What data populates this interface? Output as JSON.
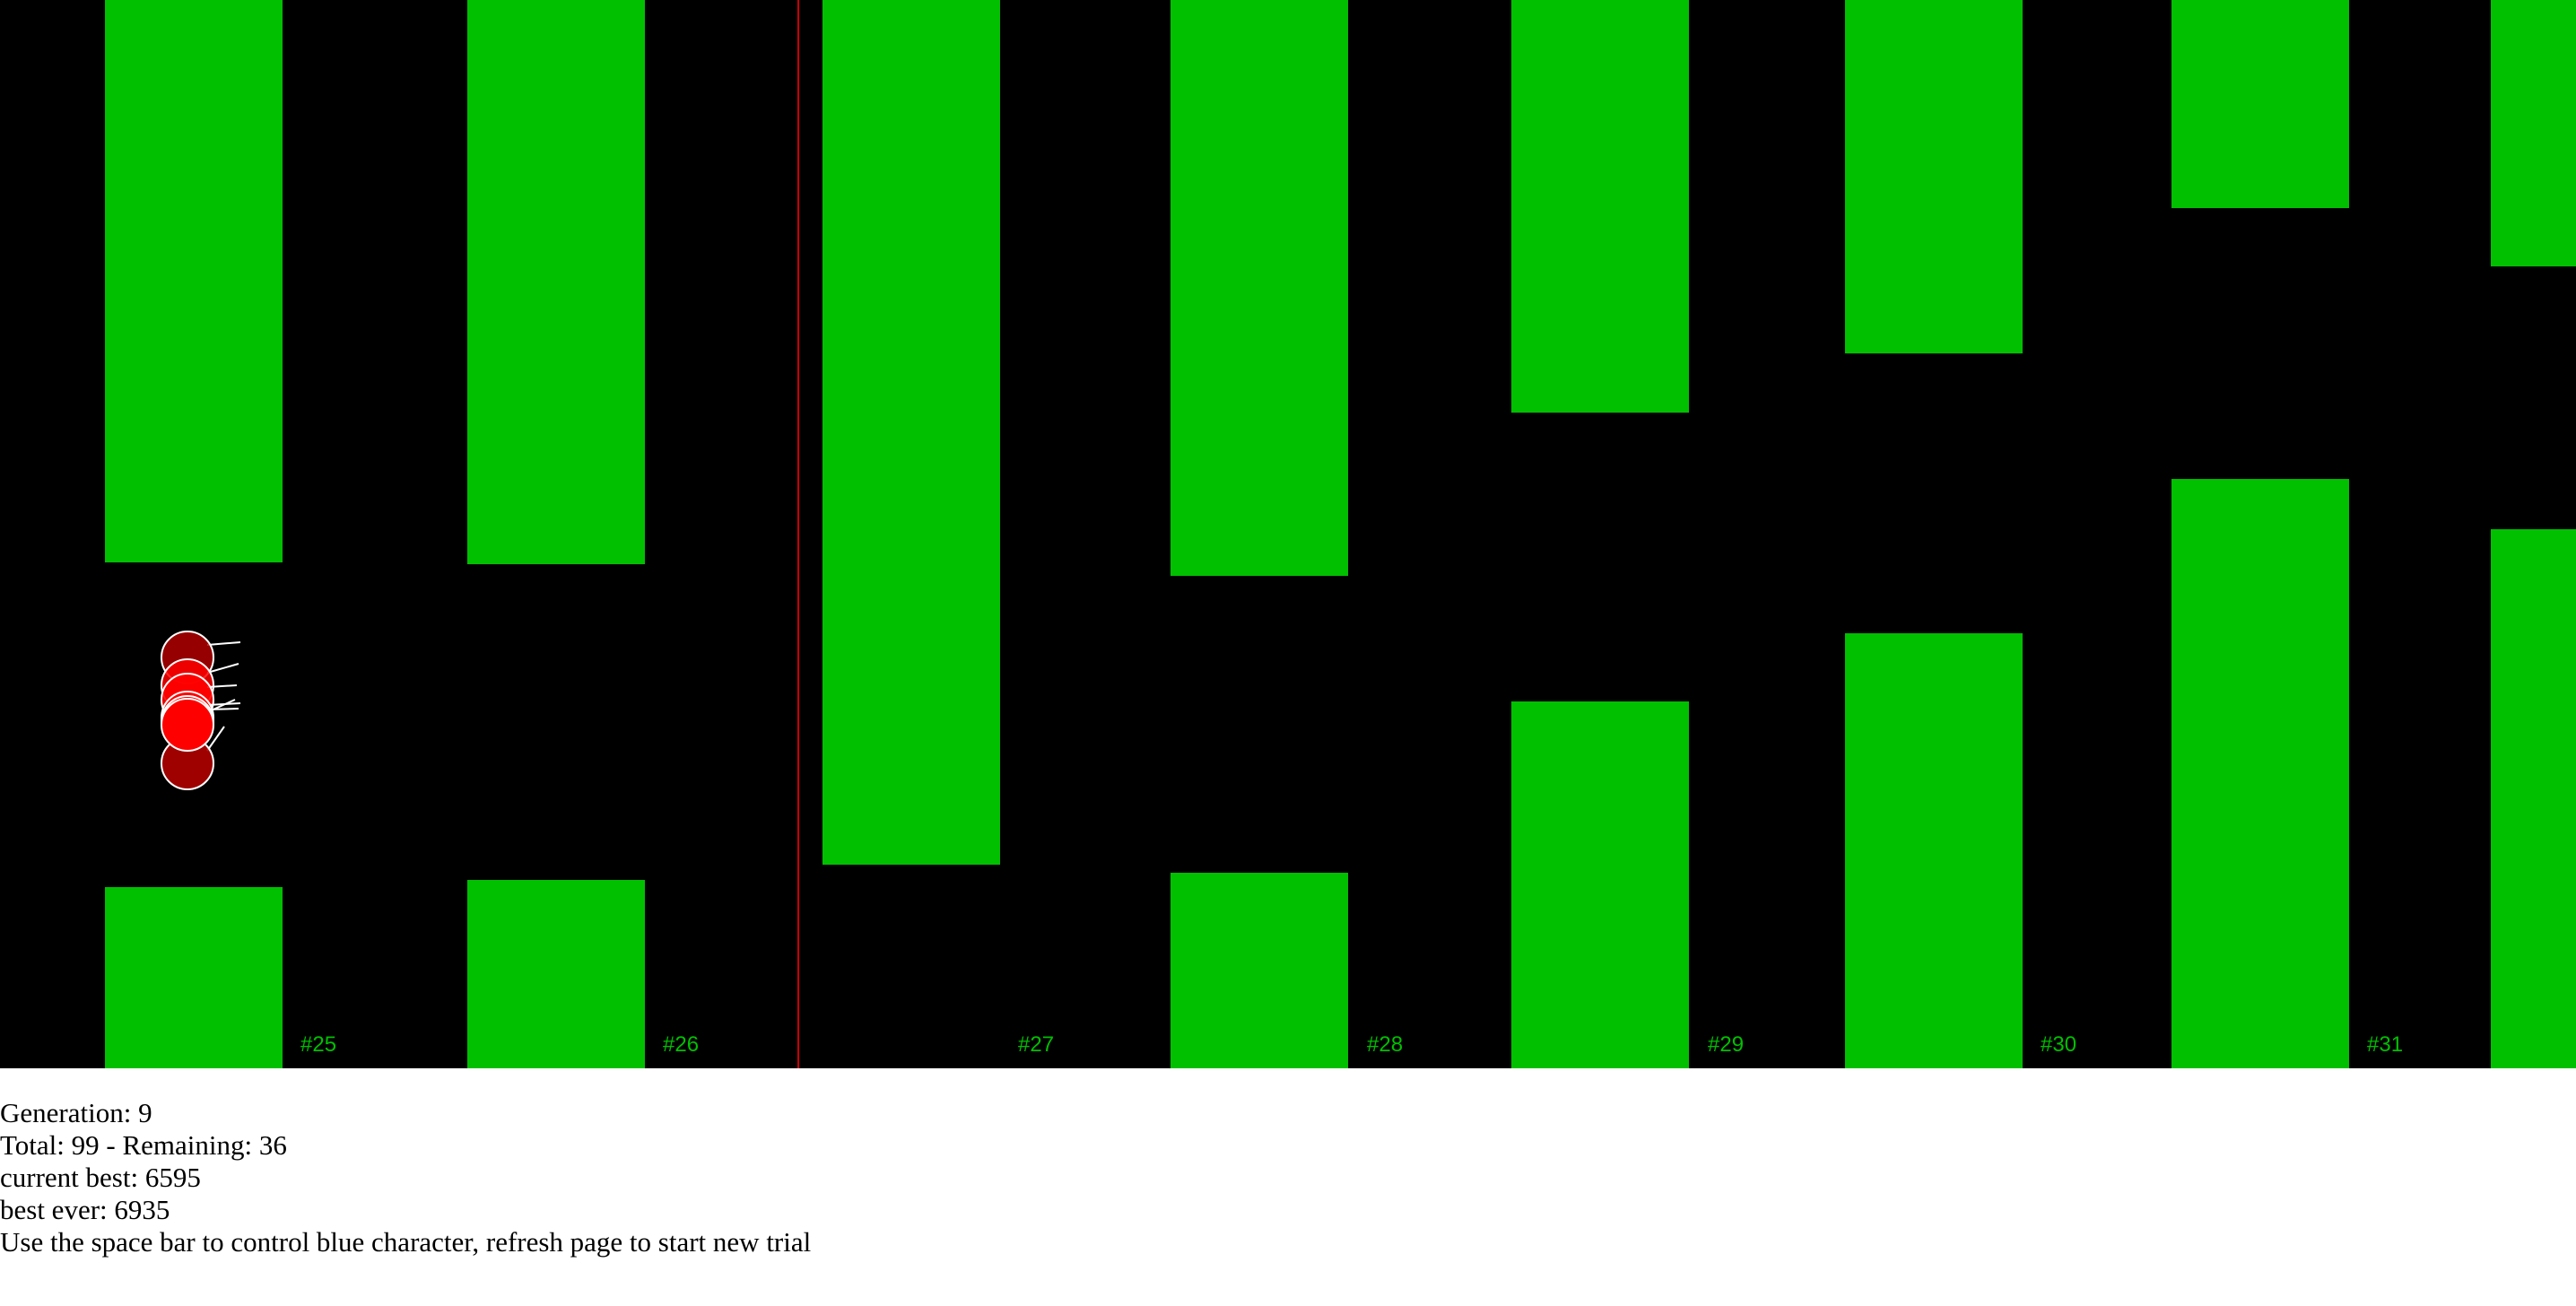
{
  "game": {
    "colors": {
      "background": "#000000",
      "pipe": "#00c000",
      "pipe_label": "#00c000",
      "divider_line": "#cc0000",
      "bird_fill": "#ff0000",
      "bird_fill_dim": "#b00000",
      "bird_outline": "#ffffff",
      "sensor_line": "#ffffff"
    },
    "pipe_labels": [
      "#25",
      "#26",
      "#27",
      "#28",
      "#29",
      "#30",
      "#31"
    ],
    "birds_alive_shown": 7
  },
  "hud": {
    "generation_label": "Generation:",
    "generation": 9,
    "total_label": "Total:",
    "total": 99,
    "remaining_label": "Remaining:",
    "remaining": 36,
    "current_best_label": "current best:",
    "current_best": 6595,
    "best_ever_label": "best ever:",
    "best_ever": 6935,
    "instructions": "Use the space bar to control blue character, refresh page to start new trial"
  }
}
